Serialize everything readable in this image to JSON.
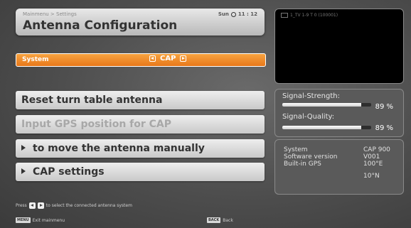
{
  "header": {
    "breadcrumb": "Mainmenu > Settings",
    "title": "Antenna Configuration",
    "day": "Sun",
    "time": "11 : 12"
  },
  "preview": {
    "channel": "1_TV 1-9 T 0 (100001)"
  },
  "system_row": {
    "label": "System",
    "value": "CAP"
  },
  "menu": [
    {
      "label": "Reset turn table antenna",
      "enabled": true,
      "submenu": false
    },
    {
      "label": "Input GPS position for CAP",
      "enabled": false,
      "submenu": false
    },
    {
      "label": "to move the antenna manually",
      "enabled": true,
      "submenu": true
    },
    {
      "label": "CAP settings",
      "enabled": true,
      "submenu": true
    }
  ],
  "signal": {
    "strength_label": "Signal-Strength:",
    "strength_pct": "89 %",
    "strength_value": 0.89,
    "quality_label": "Signal-Quality:",
    "quality_pct": "89 %",
    "quality_value": 0.89
  },
  "info": {
    "system_key": "System",
    "system_val": "CAP 900",
    "sw_key": "Software version",
    "sw_val": "V001",
    "gps_key": "Built-in GPS",
    "gps_lon": "100°E",
    "gps_lat": "10°N"
  },
  "footer": {
    "hint_pre": "Press",
    "hint_post": "to select the connected antenna system",
    "menu_key": "MENU",
    "menu_label": "Exit mainmenu",
    "back_key": "BACK",
    "back_label": "Back"
  },
  "colors": {
    "accent": "#f08a2a",
    "panel": "#5a5a5a"
  }
}
